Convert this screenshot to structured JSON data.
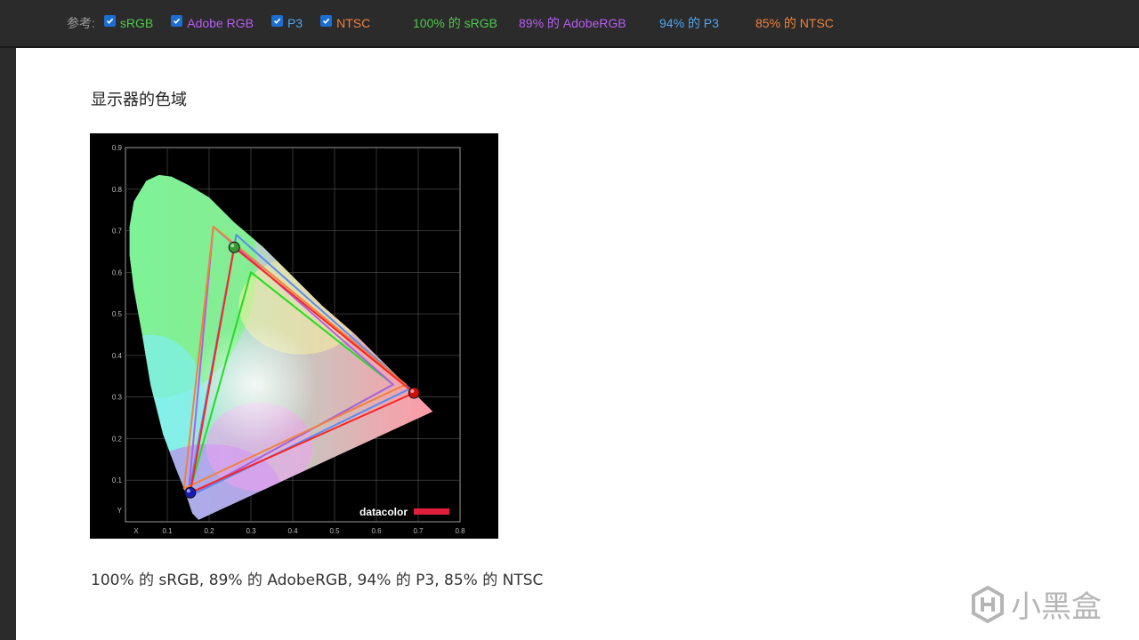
{
  "toolbar": {
    "reference_label": "参考:",
    "standards": [
      {
        "label": "sRGB",
        "color": "#4ec94e",
        "checked": true
      },
      {
        "label": "Adobe RGB",
        "color": "#b65ef0",
        "checked": true
      },
      {
        "label": "P3",
        "color": "#4da6f0",
        "checked": true
      },
      {
        "label": "NTSC",
        "color": "#f0823c",
        "checked": true
      }
    ],
    "stats": [
      {
        "label": "100% 的 sRGB",
        "color": "#4ec94e"
      },
      {
        "label": "89% 的 AdobeRGB",
        "color": "#b65ef0"
      },
      {
        "label": "94% 的 P3",
        "color": "#4da6f0"
      },
      {
        "label": "85% 的 NTSC",
        "color": "#f0823c"
      }
    ]
  },
  "content": {
    "heading": "显示器的色域",
    "caption": "100% 的 sRGB, 89% 的 AdobeRGB, 94% 的 P3, 85% 的 NTSC"
  },
  "chart_data": {
    "type": "scatter",
    "title": "",
    "xlabel": "X",
    "ylabel": "Y",
    "xlim": [
      0,
      0.8
    ],
    "ylim": [
      0,
      0.9
    ],
    "x_ticks": [
      "0.1",
      "0.2",
      "0.3",
      "0.4",
      "0.5",
      "0.6",
      "0.7",
      "0.8"
    ],
    "y_ticks": [
      "0.1",
      "0.2",
      "0.3",
      "0.4",
      "0.5",
      "0.6",
      "0.7",
      "0.8",
      "0.9"
    ],
    "grid": true,
    "brand": "datacolor",
    "gamuts": [
      {
        "name": "sRGB",
        "color": "#22dd22",
        "points": [
          [
            0.64,
            0.33
          ],
          [
            0.3,
            0.6
          ],
          [
            0.15,
            0.06
          ]
        ]
      },
      {
        "name": "Adobe RGB",
        "color": "#b05ee6",
        "points": [
          [
            0.64,
            0.33
          ],
          [
            0.21,
            0.71
          ],
          [
            0.15,
            0.06
          ]
        ]
      },
      {
        "name": "P3",
        "color": "#5a8cf0",
        "points": [
          [
            0.68,
            0.32
          ],
          [
            0.265,
            0.69
          ],
          [
            0.15,
            0.06
          ]
        ]
      },
      {
        "name": "NTSC",
        "color": "#f0823c",
        "points": [
          [
            0.67,
            0.33
          ],
          [
            0.21,
            0.71
          ],
          [
            0.14,
            0.08
          ]
        ]
      },
      {
        "name": "Display",
        "color": "#ff2222",
        "points": [
          [
            0.69,
            0.31
          ],
          [
            0.26,
            0.66
          ],
          [
            0.155,
            0.07
          ]
        ]
      }
    ],
    "primaries": [
      {
        "name": "red",
        "x": 0.69,
        "y": 0.31,
        "color": "#d01010"
      },
      {
        "name": "green",
        "x": 0.26,
        "y": 0.66,
        "color": "#3a9a3a"
      },
      {
        "name": "blue",
        "x": 0.155,
        "y": 0.07,
        "color": "#1a1ab0"
      }
    ],
    "locus": [
      [
        0.175,
        0.005
      ],
      [
        0.16,
        0.02
      ],
      [
        0.14,
        0.08
      ],
      [
        0.12,
        0.13
      ],
      [
        0.09,
        0.21
      ],
      [
        0.06,
        0.33
      ],
      [
        0.04,
        0.45
      ],
      [
        0.02,
        0.56
      ],
      [
        0.01,
        0.64
      ],
      [
        0.01,
        0.71
      ],
      [
        0.02,
        0.77
      ],
      [
        0.05,
        0.82
      ],
      [
        0.08,
        0.834
      ],
      [
        0.11,
        0.83
      ],
      [
        0.15,
        0.81
      ],
      [
        0.2,
        0.78
      ],
      [
        0.26,
        0.72
      ],
      [
        0.33,
        0.66
      ],
      [
        0.4,
        0.59
      ],
      [
        0.47,
        0.52
      ],
      [
        0.55,
        0.45
      ],
      [
        0.62,
        0.38
      ],
      [
        0.7,
        0.3
      ],
      [
        0.735,
        0.265
      ]
    ]
  }
}
